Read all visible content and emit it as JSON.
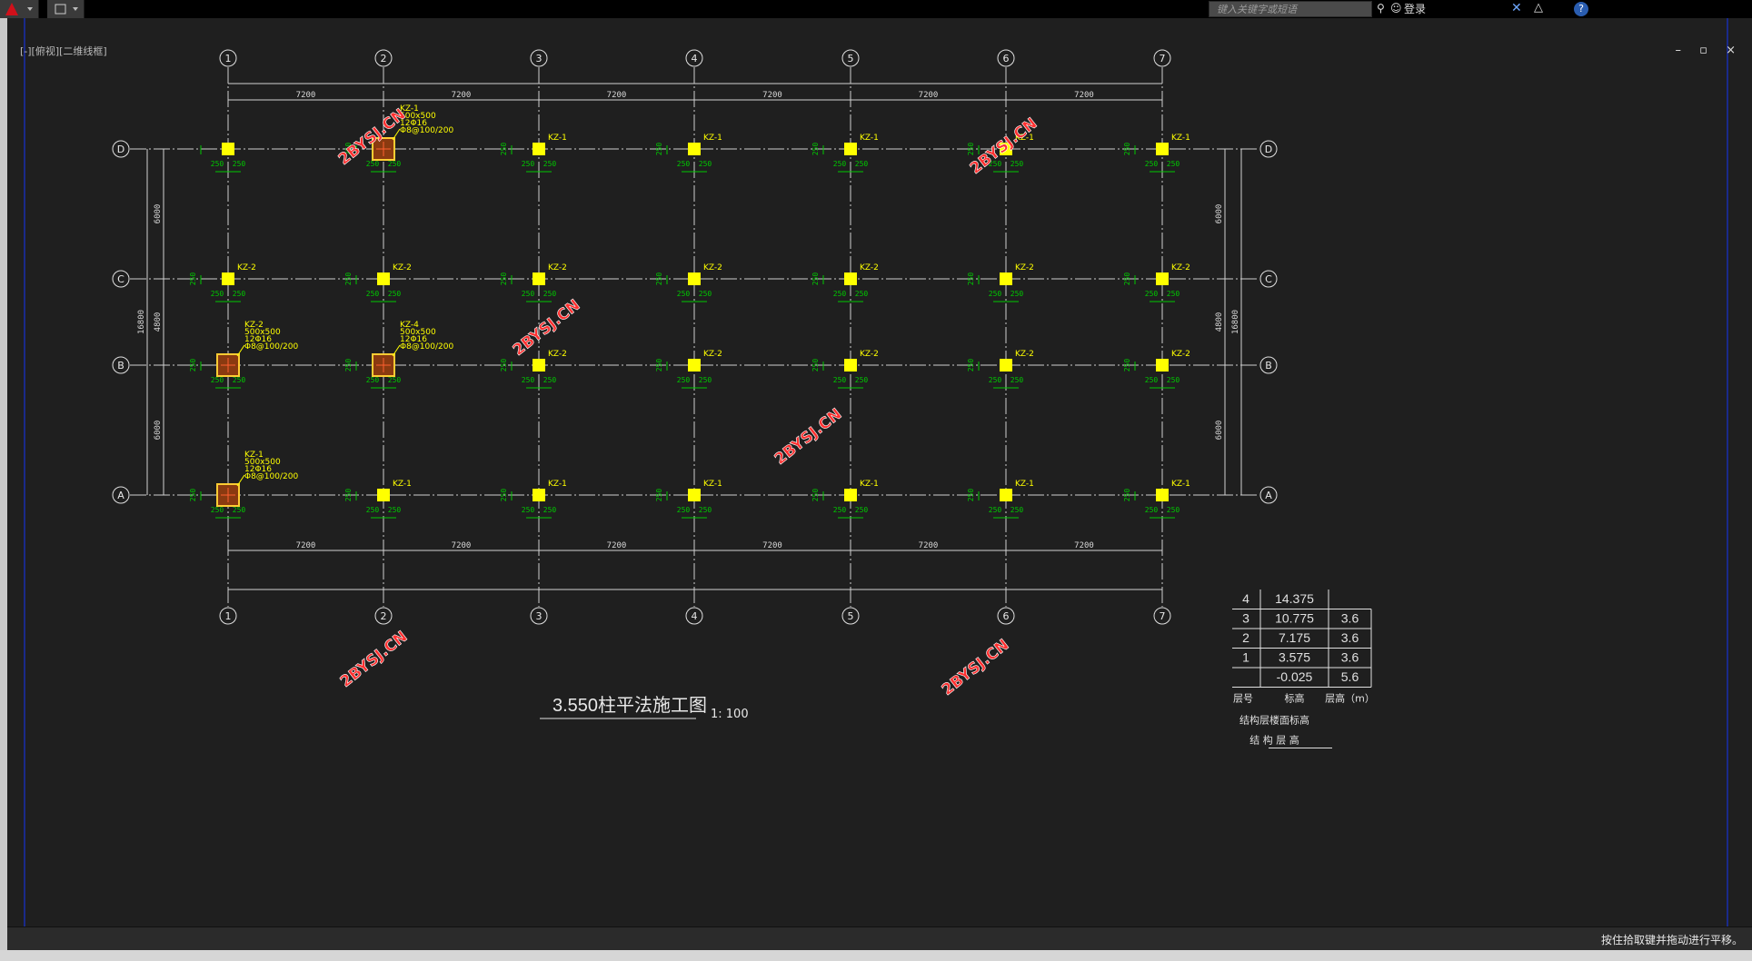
{
  "toolbar": {
    "search_placeholder": "键入关键字或短语",
    "login_label": "登录"
  },
  "viewport": {
    "label": "[-][俯视][二维线框]",
    "window_controls": "– ▫ ×"
  },
  "status_bar": {
    "text": "按住拾取键并拖动进行平移。"
  },
  "drawing": {
    "title": "3.550柱平法施工图",
    "scale": "1: 100",
    "axes_x": [
      "1",
      "2",
      "3",
      "4",
      "5",
      "6",
      "7"
    ],
    "axes_y": [
      "A",
      "B",
      "C",
      "D"
    ],
    "bay_dim": "7200",
    "span_dims_left": [
      "6000",
      "4800",
      "6000"
    ],
    "span_dims_right": [
      "6000",
      "4800",
      "6000"
    ],
    "total_dim": "16800",
    "half_dim": "250",
    "watermark": "2BYSJ.CN",
    "detail_columns": [
      {
        "id": "d2",
        "lines": [
          "KZ-1",
          "500x500",
          "12Φ16",
          "Φ8@100/200"
        ]
      },
      {
        "id": "b1",
        "lines": [
          "KZ-2",
          "500x500",
          "12Φ16",
          "Φ8@100/200"
        ]
      },
      {
        "id": "b2",
        "lines": [
          "KZ-4",
          "500x500",
          "12Φ16",
          "Φ8@100/200"
        ]
      },
      {
        "id": "a1",
        "lines": [
          "KZ-1",
          "500x500",
          "12Φ16",
          "Φ8@100/200"
        ]
      }
    ],
    "level_table": {
      "rows": [
        {
          "floor": "4",
          "elev": "14.375",
          "height": ""
        },
        {
          "floor": "3",
          "elev": "10.775",
          "height": "3.6"
        },
        {
          "floor": "2",
          "elev": "7.175",
          "height": "3.6"
        },
        {
          "floor": "1",
          "elev": "3.575",
          "height": "3.6"
        },
        {
          "floor": "",
          "elev": "-0.025",
          "height": "5.6"
        }
      ],
      "header": [
        "层号",
        "标高",
        "层高（m）"
      ],
      "caption1": "结构层楼面标高",
      "caption2": "结 构 层 高"
    }
  },
  "colors": {
    "background": "#1f1f1f",
    "column": "#ffff00",
    "rebar": "#00c800",
    "watermark": "#ff3030"
  }
}
